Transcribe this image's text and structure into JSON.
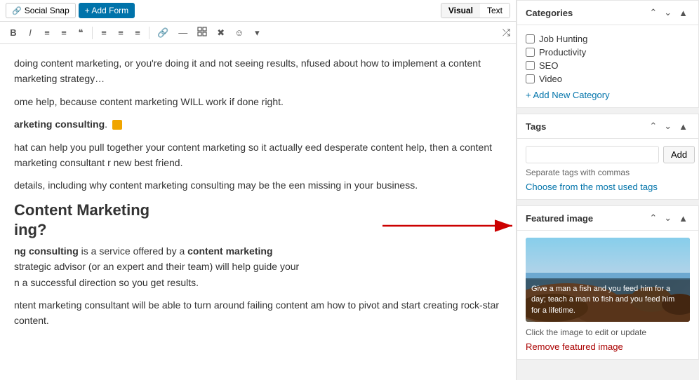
{
  "toolbar": {
    "social_snap_label": "Social Snap",
    "add_form_label": "+ Add Form",
    "visual_label": "Visual",
    "text_label": "Text"
  },
  "formatting": {
    "bold": "B",
    "italic": "I",
    "unordered_list": "≡",
    "ordered_list": "≡",
    "blockquote": "❝",
    "align_left": "≡",
    "align_center": "≡",
    "align_right": "≡",
    "link": "🔗",
    "more": "—",
    "table": "⊞",
    "clear": "✕",
    "icon": "☺",
    "dropdown": "▾",
    "expand": "⤢"
  },
  "editor": {
    "paragraph1": "doing content marketing, or you're doing it and not seeing results, nfused about how to implement a content marketing strategy…",
    "paragraph2": "ome help, because content marketing WILL work if done right.",
    "paragraph3": "arketing consulting.",
    "paragraph4": "hat can help you pull together your content marketing so it actually eed desperate content help, then a content marketing consultant r new best friend.",
    "paragraph5": "details, including why content marketing consulting may be the een missing in your business.",
    "heading": "Content Marketing ing?",
    "paragraph6": "ng consulting is a service offered by a content marketing strategic advisor (or an expert and their team) will help guide your n a successful direction so you get results.",
    "paragraph7": "ntent marketing consultant will be able to turn around failing content am how to pivot and start creating rock-star content."
  },
  "sidebar": {
    "categories_title": "Categories",
    "categories": [
      {
        "label": "Job Hunting",
        "checked": false
      },
      {
        "label": "Productivity",
        "checked": false
      },
      {
        "label": "SEO",
        "checked": false
      },
      {
        "label": "Video",
        "checked": false
      }
    ],
    "add_category_label": "+ Add New Category",
    "tags_title": "Tags",
    "tags_input_placeholder": "",
    "tags_add_label": "Add",
    "tags_hint": "Separate tags with commas",
    "tags_link": "Choose from the most used tags",
    "featured_image_title": "Featured image",
    "featured_image_overlay_text": "Give a man a fish and you feed him for a day; teach a man to fish and you feed him for a lifetime.",
    "featured_image_hint": "Click the image to edit or update",
    "remove_image_label": "Remove featured image"
  }
}
